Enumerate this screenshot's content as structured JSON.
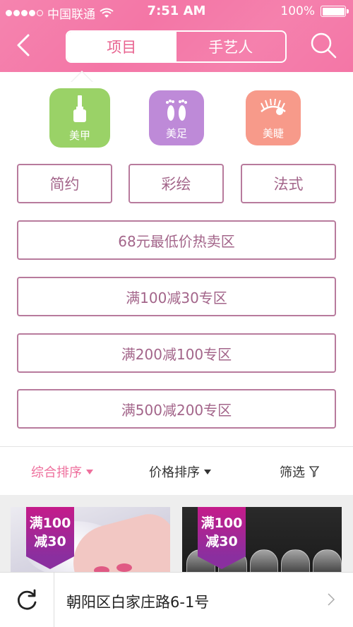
{
  "status_bar": {
    "carrier": "中国联通",
    "time": "7:51 AM",
    "battery": "100%"
  },
  "nav": {
    "tabs": [
      {
        "label": "项目",
        "active": true
      },
      {
        "label": "手艺人",
        "active": false
      }
    ]
  },
  "categories": [
    {
      "label": "美甲",
      "icon": "nail-polish-icon",
      "color": "#9ad267"
    },
    {
      "label": "美足",
      "icon": "footprints-icon",
      "color": "#be8ad8"
    },
    {
      "label": "美睫",
      "icon": "eyelash-icon",
      "color": "#f79a8a"
    }
  ],
  "styles": [
    "简约",
    "彩绘",
    "法式"
  ],
  "promo_zones": [
    "68元最低价热卖区",
    "满100减30专区",
    "满200减100专区",
    "满500减200专区"
  ],
  "sort": {
    "comprehensive": "综合排序",
    "price": "价格排序",
    "filter": "筛选"
  },
  "products": [
    {
      "badge_line1": "满100",
      "badge_line2": "减30"
    },
    {
      "badge_line1": "满100",
      "badge_line2": "减30"
    }
  ],
  "location": {
    "address": "朝阳区白家庄路6-1号"
  },
  "colors": {
    "header": "#f476a6",
    "accent": "#ee6f9c",
    "button_border": "#b87b9d",
    "button_text": "#a3658a"
  }
}
